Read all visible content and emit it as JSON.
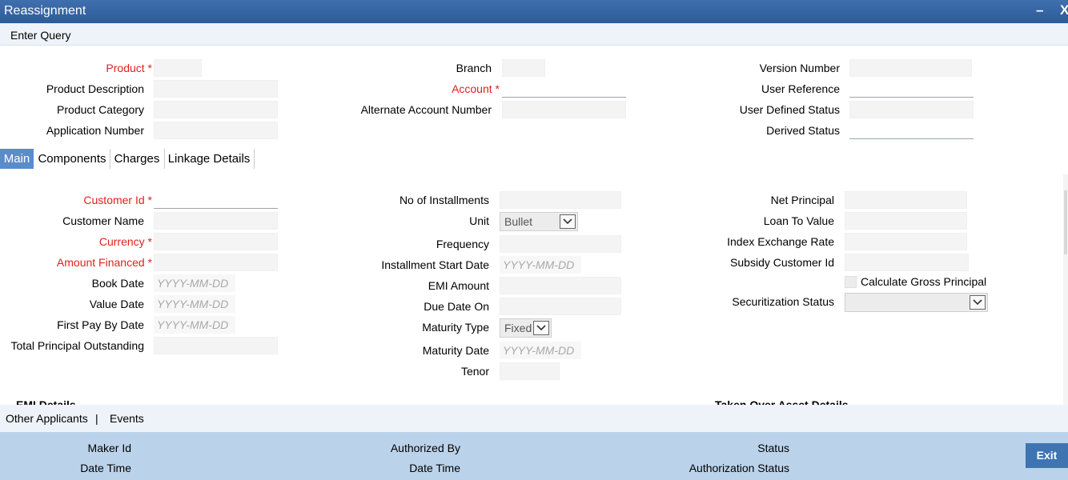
{
  "window": {
    "title": "Reassignment",
    "minimize": "–",
    "close": "X"
  },
  "toolbar": {
    "enter_query": "Enter Query"
  },
  "header": {
    "product": "Product",
    "product_description": "Product Description",
    "product_category": "Product Category",
    "application_number": "Application Number",
    "branch": "Branch",
    "account": "Account",
    "alternate_account_number": "Alternate Account Number",
    "version_number": "Version Number",
    "user_reference": "User Reference",
    "user_defined_status": "User Defined Status",
    "derived_status": "Derived Status",
    "required_mark": "*"
  },
  "tabs": [
    "Main",
    "Components",
    "Charges",
    "Linkage Details"
  ],
  "main": {
    "customer_id": "Customer Id",
    "customer_name": "Customer Name",
    "currency": "Currency",
    "amount_financed": "Amount Financed",
    "book_date": "Book Date",
    "value_date": "Value Date",
    "first_pay_by_date": "First Pay By Date",
    "total_principal_outstanding": "Total Principal Outstanding",
    "no_of_installments": "No of Installments",
    "unit": "Unit",
    "unit_value": "Bullet",
    "frequency": "Frequency",
    "installment_start_date": "Installment Start Date",
    "emi_amount": "EMI Amount",
    "due_date_on": "Due Date On",
    "maturity_type": "Maturity Type",
    "maturity_type_value": "Fixed",
    "maturity_date": "Maturity Date",
    "tenor": "Tenor",
    "net_principal": "Net Principal",
    "loan_to_value": "Loan To Value",
    "index_exchange_rate": "Index Exchange Rate",
    "subsidy_customer_id": "Subsidy Customer Id",
    "calculate_gross_principal": "Calculate Gross Principal",
    "securitization_status": "Securitization Status",
    "date_placeholder": "YYYY-MM-DD",
    "emi_details": "EMI Details",
    "taken_over_asset_details": "Taken Over Asset Details"
  },
  "footer_links": {
    "other_applicants": "Other Applicants",
    "separator": "|",
    "events": "Events"
  },
  "audit": {
    "maker_id": "Maker Id",
    "date_time": "Date Time",
    "authorized_by": "Authorized By",
    "date_time_2": "Date Time",
    "status": "Status",
    "authorization_status": "Authorization Status",
    "exit": "Exit"
  }
}
